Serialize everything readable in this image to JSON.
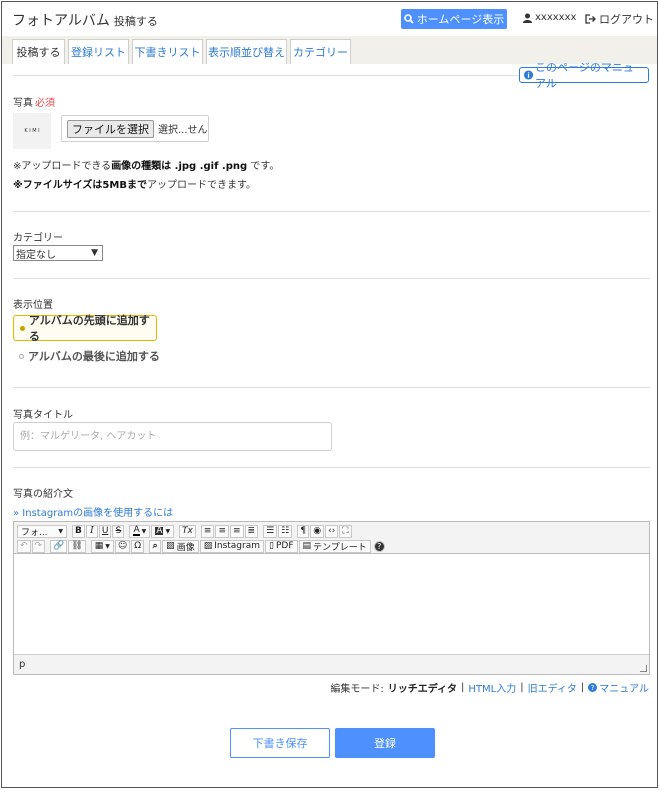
{
  "header": {
    "title": "フォトアルバム",
    "subtitle": "投稿する",
    "homepage_button": "ホームページ表示",
    "username": "xxxxxxx",
    "logout": "ログアウト"
  },
  "tabs": [
    {
      "label": "投稿する",
      "active": true
    },
    {
      "label": "登録リスト"
    },
    {
      "label": "下書きリスト"
    },
    {
      "label": "表示順並び替え"
    },
    {
      "label": "カテゴリー"
    }
  ],
  "manual_link": "このページのマニュアル",
  "photo": {
    "label": "写真",
    "required": "必須",
    "thumb_text": "K I M I",
    "file_button": "ファイルを選択",
    "file_status": "選択...せん",
    "note1_pre": "※アップロードできる",
    "note1_bold": "画像の種類は .jpg .gif .png",
    "note1_post": " です。",
    "note2_bold": "※ファイルサイズは5MBまで",
    "note2_post": "アップロードできます。"
  },
  "category": {
    "label": "カテゴリー",
    "selected": "指定なし",
    "arrow": "▼"
  },
  "position": {
    "label": "表示位置",
    "option_first": "アルバムの先頭に追加する",
    "option_last": "アルバムの最後に追加する",
    "selected": "first"
  },
  "photo_title": {
    "label": "写真タイトル",
    "placeholder": "例：マルゲリータ, ヘアカット"
  },
  "description": {
    "label": "写真の紹介文",
    "instagram_link": "» Instagramの画像を使用するには"
  },
  "editor": {
    "format_label": "フォ...",
    "image_button": "画像",
    "instagram_button": "Instagram",
    "pdf_button": "PDF",
    "template_button": "テンプレート",
    "status_path": "p"
  },
  "mode_bar": {
    "prefix": "編集モード:",
    "current": "リッチエディタ",
    "html": "HTML入力",
    "old": "旧エディタ",
    "manual": "マニュアル",
    "sep": "|"
  },
  "actions": {
    "draft": "下書き保存",
    "submit": "登録"
  },
  "colors": {
    "accent": "#4d90fe",
    "link": "#2e7bd6",
    "required": "#e84a4a",
    "selected_border": "#e6b800"
  }
}
